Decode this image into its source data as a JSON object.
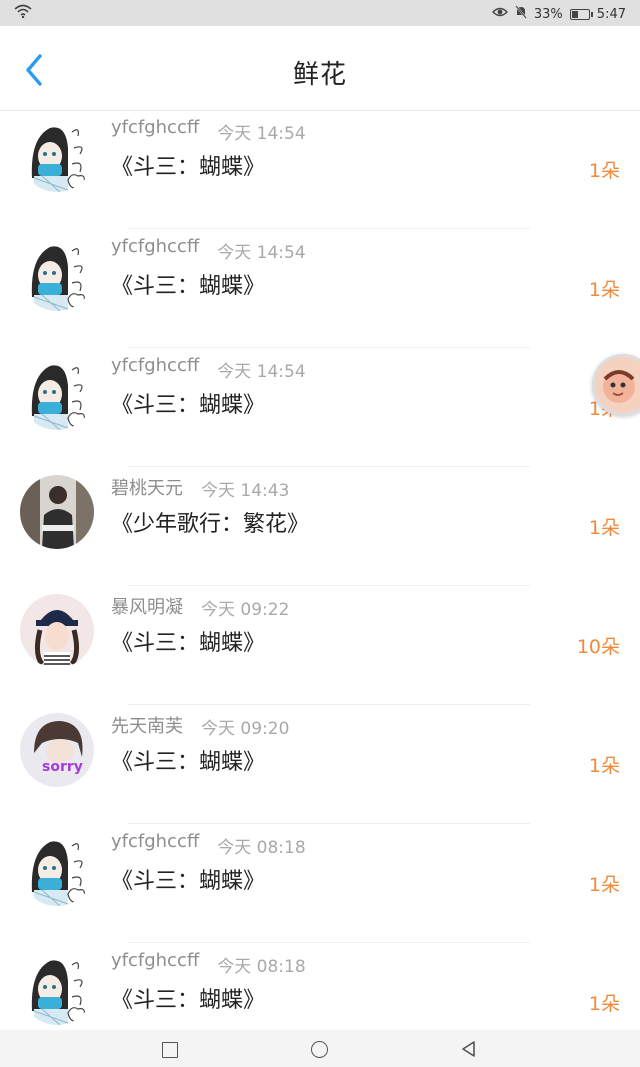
{
  "status_bar": {
    "battery_percent": "33%",
    "time": "5:47",
    "icons": [
      "wifi-icon",
      "eye-icon",
      "mute-icon",
      "battery-icon"
    ]
  },
  "header": {
    "title": "鲜花",
    "back_icon": "chevron-left-icon"
  },
  "flowers": [
    {
      "name": "yfcfghccff",
      "time": "今天 14:54",
      "gift": "《斗三：蝴蝶》",
      "count": "1朵",
      "avatar": "anime-girl"
    },
    {
      "name": "yfcfghccff",
      "time": "今天 14:54",
      "gift": "《斗三：蝴蝶》",
      "count": "1朵",
      "avatar": "anime-girl"
    },
    {
      "name": "yfcfghccff",
      "time": "今天 14:54",
      "gift": "《斗三：蝴蝶》",
      "count": "1朵",
      "avatar": "anime-girl"
    },
    {
      "name": "碧桃天元",
      "time": "今天 14:43",
      "gift": "《少年歌行：繁花》",
      "count": "1朵",
      "avatar": "photo-man"
    },
    {
      "name": "暴风明凝",
      "time": "今天 09:22",
      "gift": "《斗三：蝴蝶》",
      "count": "10朵",
      "avatar": "photo-girl-cap"
    },
    {
      "name": "先天南芙",
      "time": "今天 09:20",
      "gift": "《斗三：蝴蝶》",
      "count": "1朵",
      "avatar": "photo-girl-sorry"
    },
    {
      "name": "yfcfghccff",
      "time": "今天 08:18",
      "gift": "《斗三：蝴蝶》",
      "count": "1朵",
      "avatar": "anime-girl"
    },
    {
      "name": "yfcfghccff",
      "time": "今天 08:18",
      "gift": "《斗三：蝴蝶》",
      "count": "1朵",
      "avatar": "anime-girl"
    }
  ],
  "avatar_texts": {
    "sorry": "sorry"
  },
  "colors": {
    "accent_blue": "#2b9cf0",
    "count_orange": "#f08a3c",
    "name_gray": "#8e8e8e"
  },
  "system_nav": [
    "square-icon",
    "circle-icon",
    "triangle-back-icon"
  ]
}
